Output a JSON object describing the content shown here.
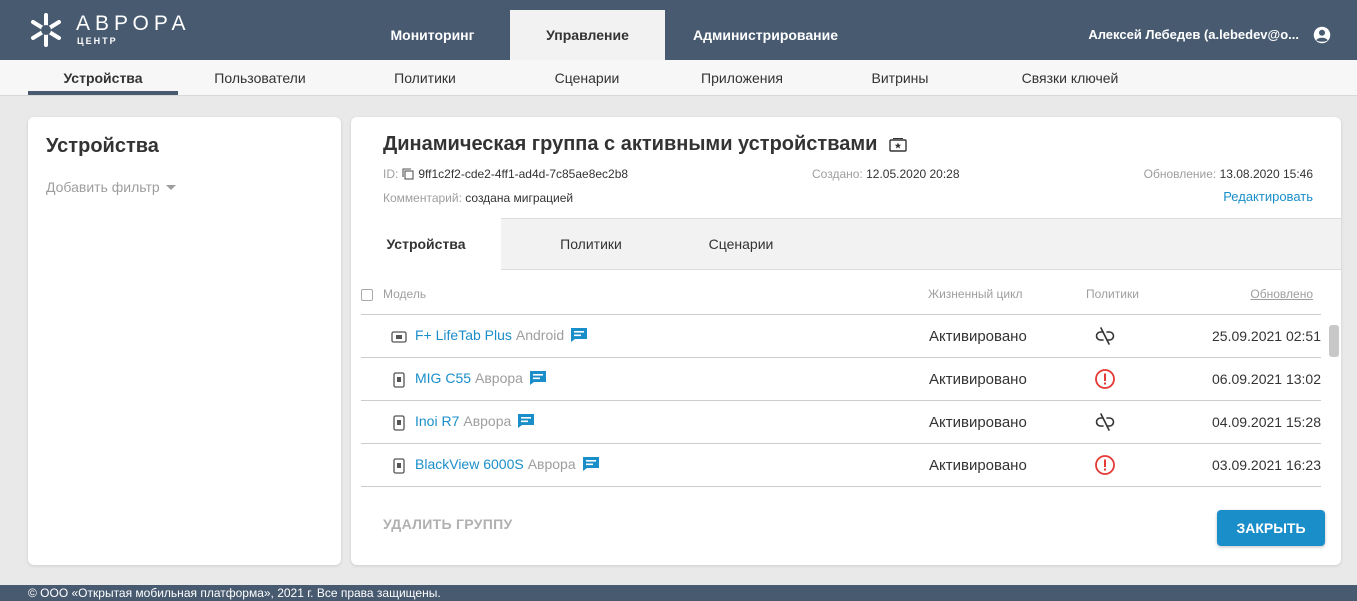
{
  "brand": {
    "name": "АВРОРА",
    "sub": "ЦЕНТР"
  },
  "nav": {
    "items": [
      {
        "label": "Мониторинг",
        "active": false
      },
      {
        "label": "Управление",
        "active": true
      },
      {
        "label": "Администрирование",
        "active": false
      }
    ]
  },
  "user": {
    "name": "Алексей Лебедев (a.lebedev@o...",
    "icon": "account-circle-icon"
  },
  "subnav": {
    "items": [
      {
        "label": "Устройства"
      },
      {
        "label": "Пользователи"
      },
      {
        "label": "Политики"
      },
      {
        "label": "Сценарии"
      },
      {
        "label": "Приложения"
      },
      {
        "label": "Витрины"
      },
      {
        "label": "Связки ключей"
      }
    ]
  },
  "sidebar": {
    "title": "Устройства",
    "add_filter": "Добавить фильтр"
  },
  "group": {
    "title": "Динамическая группа с активными устройствами",
    "id_label": "ID:",
    "id_value": "9ff1c2f2-cde2-4ff1-ad4d-7c85ae8ec2b8",
    "comment_label": "Комментарий:",
    "comment_value": "создана миграцией",
    "created_label": "Создано:",
    "created_value": "12.05.2020 20:28",
    "updated_label": "Обновление:",
    "updated_value": "13.08.2020 15:46",
    "edit": "Редактировать"
  },
  "tabs": [
    {
      "label": "Устройства",
      "active": true
    },
    {
      "label": "Политики",
      "active": false
    },
    {
      "label": "Сценарии",
      "active": false
    }
  ],
  "table": {
    "headers": {
      "model": "Модель",
      "lifecycle": "Жизненный цикл",
      "policies": "Политики",
      "updated": "Обновлено"
    },
    "rows": [
      {
        "device_type": "tablet",
        "model": "F+ LifeTab Plus",
        "os": "Android",
        "lifecycle": "Активировано",
        "policy_status": "unlinked",
        "updated": "25.09.2021 02:51"
      },
      {
        "device_type": "phone",
        "model": "MIG C55",
        "os": "Аврора",
        "lifecycle": "Активировано",
        "policy_status": "error",
        "updated": "06.09.2021 13:02"
      },
      {
        "device_type": "phone",
        "model": "Inoi R7",
        "os": "Аврора",
        "lifecycle": "Активировано",
        "policy_status": "unlinked",
        "updated": "04.09.2021 15:28"
      },
      {
        "device_type": "phone",
        "model": "BlackView 6000S",
        "os": "Аврора",
        "lifecycle": "Активировано",
        "policy_status": "error",
        "updated": "03.09.2021 16:23"
      }
    ]
  },
  "actions": {
    "delete": "УДАЛИТЬ ГРУППУ",
    "close": "ЗАКРЫТЬ"
  },
  "footer": "© ООО «Открытая мобильная платформа», 2021 г. Все права защищены.",
  "colors": {
    "header": "#475a70",
    "accent": "#1a8ec9",
    "error": "#e53935",
    "background": "#e9e9e9"
  }
}
